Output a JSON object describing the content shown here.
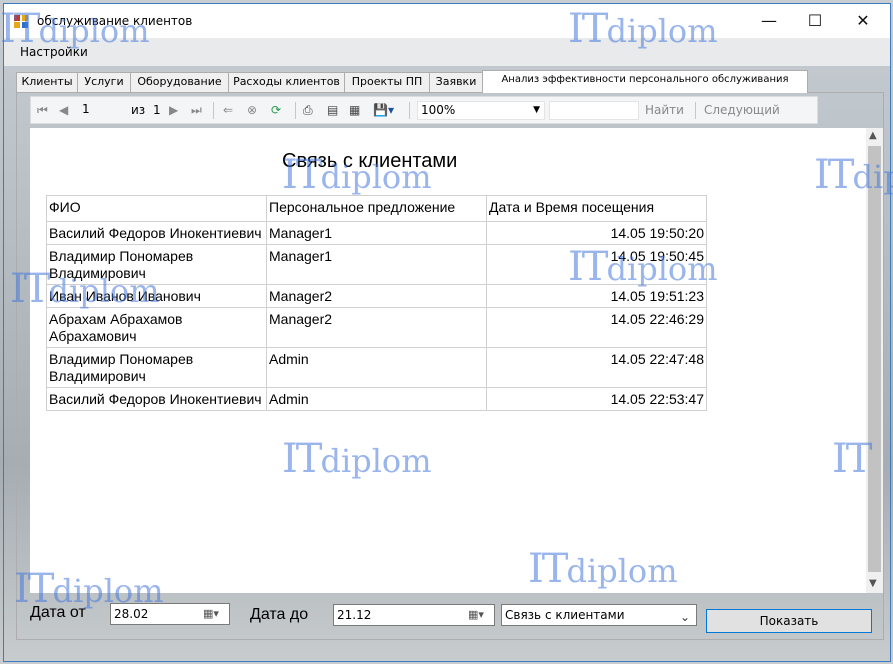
{
  "window": {
    "title": "обслуживание клиентов"
  },
  "menu": {
    "settings": "Настройки"
  },
  "tabs": [
    {
      "label": "Клиенты"
    },
    {
      "label": "Услуги"
    },
    {
      "label": "Оборудование"
    },
    {
      "label": "Расходы клиентов"
    },
    {
      "label": "Проекты ПП"
    },
    {
      "label": "Заявки"
    },
    {
      "label": "Анализ эффективности персонального обслуживания",
      "active": true
    }
  ],
  "toolbar": {
    "page_current": "1",
    "page_of_label": "из",
    "page_total": "1",
    "zoom": "100%",
    "find_label": "Найти",
    "next_label": "Следующий"
  },
  "report": {
    "title": "Связь с клиентами",
    "columns": [
      "ФИО",
      "Персональное предложение",
      "Дата и Время посещения"
    ],
    "rows": [
      [
        "Василий Федоров Инокентиевич",
        "Manager1",
        "14.05 19:50:20"
      ],
      [
        "Владимир Пономарев Владимирович",
        "Manager1",
        "14.05 19:50:45"
      ],
      [
        "Иван Иванов Иванович",
        "Manager2",
        "14.05 19:51:23"
      ],
      [
        "Абрахам Абрахамов Абрахамович",
        "Manager2",
        "14.05 22:46:29"
      ],
      [
        "Владимир Пономарев Владимирович",
        "Admin",
        "14.05 22:47:48"
      ],
      [
        "Василий Федоров Инокентиевич",
        "Admin",
        "14.05 22:53:47"
      ]
    ]
  },
  "filters": {
    "date_from_label": "Дата от",
    "date_from_value": "28.02",
    "date_to_label": "Дата до",
    "date_to_value": "21.12",
    "report_select_value": "Связь с клиентами",
    "show_button": "Показать"
  },
  "watermark": {
    "it": "IT",
    "diplom": "diplom"
  },
  "colors": {
    "accent": "#0078d7",
    "watermark": "#4678dc"
  }
}
